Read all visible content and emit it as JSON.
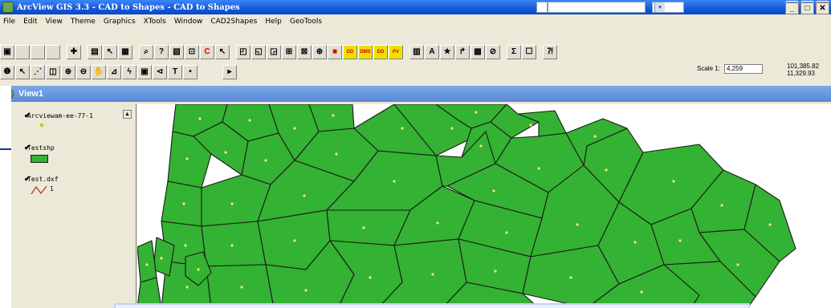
{
  "window": {
    "title": "ArcView GIS 3.3  -  CAD to Shapes - CAD to Shapes",
    "combo_value": "",
    "combo2_value": "",
    "minimize": "_",
    "restore": "❐",
    "close": "✕"
  },
  "menu": [
    "File",
    "Edit",
    "View",
    "Theme",
    "Graphics",
    "XTools",
    "Window",
    "CAD2Shapes",
    "Help",
    "GeoTools"
  ],
  "toolbar3": {
    "scale_label": "Scale 1:",
    "scale_value": "4,259",
    "coord_x": "101,385.82",
    "coord_y": "11,329.93"
  },
  "view": {
    "title": "View1",
    "minimize": "_",
    "restore": "□",
    "close": "✕"
  },
  "toc": {
    "themes": [
      {
        "name": "Arcviewam-ee-77-1",
        "checked": true,
        "legend": "point"
      },
      {
        "name": "Testshp",
        "checked": true,
        "legend": "polygon"
      },
      {
        "name": "Test.dxf",
        "checked": true,
        "legend": "line",
        "legend_value": "1"
      }
    ]
  },
  "colors": {
    "polygon_fill": "#34b233",
    "polygon_stroke": "#1a1a1a",
    "point": "#f3ec6a",
    "line_symbol": "#c0392b"
  }
}
